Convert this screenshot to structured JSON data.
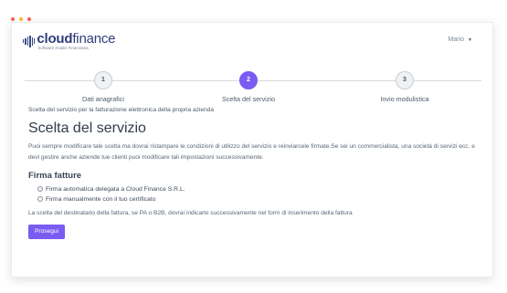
{
  "window_controls": {
    "colors": [
      "#ff5f57",
      "#febc2e",
      "#ff5f57"
    ]
  },
  "brand": {
    "title_bold": "cloud",
    "title_light": "finance",
    "tagline": "Software Analisi Finanziaria",
    "color": "#2f3d7a"
  },
  "user_menu": {
    "label": "Mario"
  },
  "stepper": {
    "steps": [
      {
        "number": "1",
        "label": "Dati anagrafici",
        "active": false
      },
      {
        "number": "2",
        "label": "Scelta del servizio",
        "active": true
      },
      {
        "number": "3",
        "label": "Invio modulistica",
        "active": false
      }
    ],
    "accent": "#7a5cf2"
  },
  "main": {
    "intro": "Scelta del servizio per la fatturazione elettronica della propria azienda",
    "title": "Scelta del servizio",
    "description": "Puoi sempre modificare tale scelta ma dovrai ristampare le condizioni di utilizzo del servizio e reinviarcele firmate.Se sei un commercialista, una società di servizi ecc. e devi gestire anche aziende tue clienti puoi modificare tali impostazioni successivamente.",
    "section_title": "Firma fatture",
    "options": [
      {
        "label": "Firma automatica delegata a Cloud Finance S.R.L.",
        "selected": false
      },
      {
        "label": "Firma manualmente con il tuo certificato",
        "selected": false
      }
    ],
    "note": "La scelta del destinatario della fattura, se PA o B2B, dovrai indicarlo successivamente nel form di inserimento della fattura",
    "continue_button": "Prosegui"
  }
}
